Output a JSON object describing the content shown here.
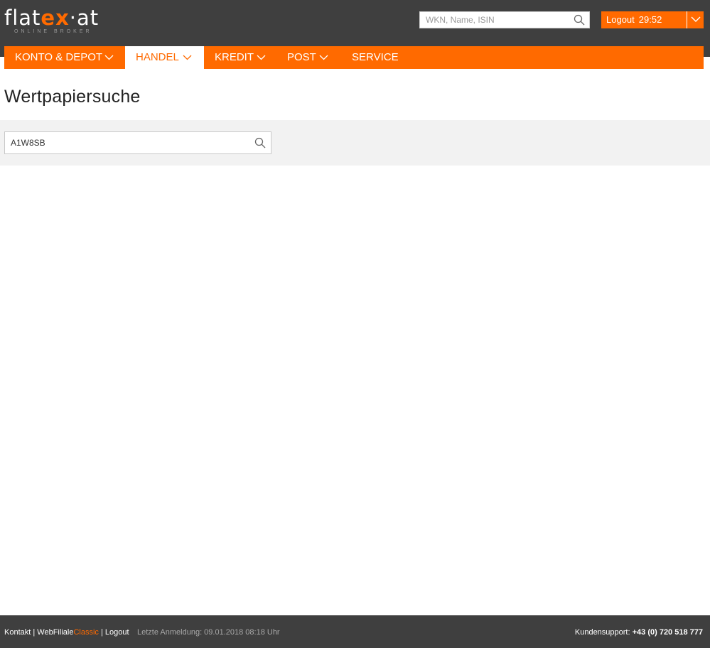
{
  "header": {
    "logo": {
      "main_prefix": "flat",
      "main_ex": "ex",
      "main_suffix": "·at",
      "sub": "ONLINE BROKER"
    },
    "search": {
      "placeholder": "WKN, Name, ISIN",
      "value": ""
    },
    "logout": {
      "label": "Logout",
      "timer": "29:52"
    }
  },
  "nav": {
    "items": [
      {
        "label": "KONTO & DEPOT",
        "has_dropdown": true,
        "active": false
      },
      {
        "label": "HANDEL",
        "has_dropdown": true,
        "active": true
      },
      {
        "label": "KREDIT",
        "has_dropdown": true,
        "active": false
      },
      {
        "label": "POST",
        "has_dropdown": true,
        "active": false
      },
      {
        "label": "SERVICE",
        "has_dropdown": false,
        "active": false
      }
    ]
  },
  "main": {
    "title": "Wertpapiersuche",
    "search": {
      "value": "A1W8SB"
    }
  },
  "footer": {
    "kontakt": "Kontakt",
    "sep1": " | ",
    "webfiliale": "WebFiliale",
    "classic": "Classic",
    "sep2": " | ",
    "logout": "Logout",
    "last_login": "Letzte Anmeldung: 09.01.2018 08:18 Uhr",
    "support_label": "Kundensupport: ",
    "support_phone": "+43 (0) 720 518 777"
  },
  "colors": {
    "brand_orange": "#ff6a00",
    "header_dark": "#3f3f3f",
    "panel_gray": "#f2f2f2"
  }
}
